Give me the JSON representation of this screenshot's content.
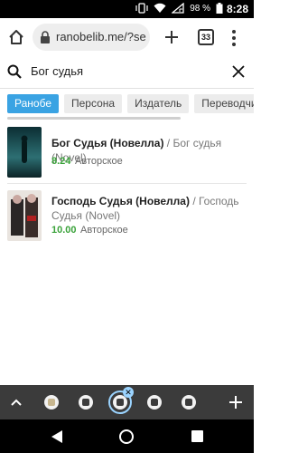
{
  "status_bar": {
    "battery": "98 %",
    "time": "8:28"
  },
  "browser": {
    "url": "ranobelib.me/?se",
    "tab_count": "33"
  },
  "search": {
    "query": "Бог судья"
  },
  "chips": [
    {
      "label": "Ранобе",
      "active": true
    },
    {
      "label": "Персона",
      "active": false
    },
    {
      "label": "Издатель",
      "active": false
    },
    {
      "label": "Переводчик",
      "active": false
    }
  ],
  "results": [
    {
      "title": "Бог Судья (Новелла)",
      "alt_title": " / Бог судья (Novel)",
      "rating": "8.24",
      "type": "Авторское"
    },
    {
      "title": "Господь Судья (Новелла)",
      "alt_title": " / Господь Судья (Novel)",
      "rating": "10.00",
      "type": "Авторское"
    }
  ],
  "icons": {
    "home": "home-icon",
    "lock": "lock-icon",
    "new_tab": "plus-icon",
    "menu": "kebab-menu-icon",
    "search": "search-icon",
    "clear": "close-icon",
    "wifi": "wifi-icon",
    "vibrate": "vibrate-icon",
    "signal": "signal-icon",
    "battery": "battery-icon"
  },
  "colors": {
    "accent": "#3aa3e3",
    "rating": "#3aa23a",
    "tab_strip": "#3b3b3b"
  }
}
